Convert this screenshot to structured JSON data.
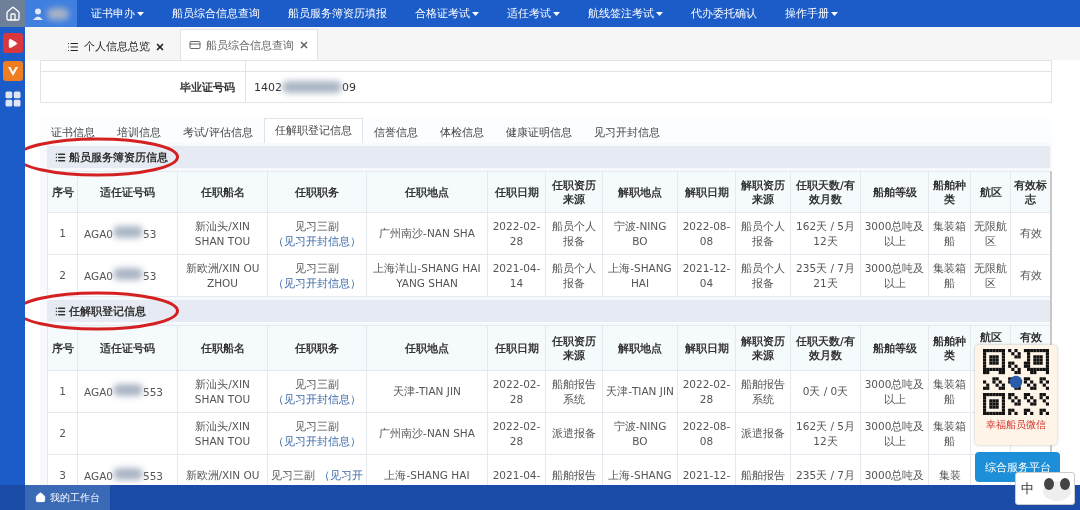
{
  "nav": {
    "items": [
      {
        "label": "证书申办",
        "has_menu": true
      },
      {
        "label": "船员综合信息查询",
        "has_menu": false
      },
      {
        "label": "船员服务簿资历填报",
        "has_menu": false
      },
      {
        "label": "合格证考试",
        "has_menu": true
      },
      {
        "label": "适任考试",
        "has_menu": true
      },
      {
        "label": "航线签注考试",
        "has_menu": true
      },
      {
        "label": "代办委托确认",
        "has_menu": false
      },
      {
        "label": "操作手册",
        "has_menu": true
      }
    ]
  },
  "page_tabs": [
    {
      "label": "个人信息总览",
      "selected": false
    },
    {
      "label": "船员综合信息查询",
      "selected": true
    }
  ],
  "info_table": {
    "label": "毕业证号码",
    "value_start": "1402",
    "value_end": "09"
  },
  "sub_tabs": [
    {
      "label": "证书信息",
      "selected": false
    },
    {
      "label": "培训信息",
      "selected": false
    },
    {
      "label": "考试/评估信息",
      "selected": false
    },
    {
      "label": "任解职登记信息",
      "selected": true
    },
    {
      "label": "信誉信息",
      "selected": false
    },
    {
      "label": "体检信息",
      "selected": false
    },
    {
      "label": "健康证明信息",
      "selected": false
    },
    {
      "label": "见习开封信息",
      "selected": false
    }
  ],
  "sections": [
    {
      "title": "船员服务簿资历信息",
      "columns": [
        "序号",
        "适任证号码",
        "任职船名",
        "任职职务",
        "任职地点",
        "任职日期",
        "任职资历来源",
        "解职地点",
        "解职日期",
        "解职资历来源",
        "任职天数/有效月数",
        "船舶等级",
        "船舶种类",
        "航区",
        "有效标志"
      ],
      "rows": [
        {
          "seq": "1",
          "cert_start": "AGA0",
          "cert_end": "53",
          "ship": "新汕头/XIN SHAN TOU",
          "duty": "见习三副",
          "duty_link": "（见习开封信息）",
          "place": "广州南沙-NAN SHA",
          "on_date": "2022-02-28",
          "on_source": "船员个人报备",
          "off_place": "宁波-NING BO",
          "off_date": "2022-08-08",
          "off_source": "船员个人报备",
          "days": "162天 / 5月12天",
          "grade": "3000总吨及以上",
          "ship_type": "集装箱船",
          "area": "无限航区",
          "flag": "有效"
        },
        {
          "seq": "2",
          "cert_start": "AGA0",
          "cert_end": "53",
          "ship": "新欧洲/XIN OU ZHOU",
          "duty": "见习三副",
          "duty_link": "（见习开封信息）",
          "place": "上海洋山-SHANG HAI YANG SHAN",
          "on_date": "2021-04-14",
          "on_source": "船员个人报备",
          "off_place": "上海-SHANG HAI",
          "off_date": "2021-12-04",
          "off_source": "船员个人报备",
          "days": "235天 / 7月21天",
          "grade": "3000总吨及以上",
          "ship_type": "集装箱船",
          "area": "无限航区",
          "flag": "有效"
        }
      ]
    },
    {
      "title": "任解职登记信息",
      "columns": [
        "序号",
        "适任证号码",
        "任职船名",
        "任职职务",
        "任职地点",
        "任职日期",
        "任职资历来源",
        "解职地点",
        "解职日期",
        "解职资历来源",
        "任职天数/有效月数",
        "船舶等级",
        "船舶种类",
        "航区",
        "有效"
      ],
      "rows": [
        {
          "seq": "1",
          "cert_start": "AGA0",
          "cert_end": "553",
          "ship": "新汕头/XIN SHAN TOU",
          "duty": "见习三副",
          "duty_link": "（见习开封信息）",
          "place": "天津-TIAN JIN",
          "on_date": "2022-02-28",
          "on_source": "船舶报告系统",
          "off_place": "天津-TIAN JIN",
          "off_date": "2022-02-28",
          "off_source": "船舶报告系统",
          "days": "0天 / 0天",
          "grade": "3000总吨及以上",
          "ship_type": "集装箱船"
        },
        {
          "seq": "2",
          "ship": "新汕头/XIN SHAN TOU",
          "duty": "见习三副",
          "duty_link": "（见习开封信息）",
          "place": "广州南沙-NAN SHA",
          "on_date": "2022-02-28",
          "on_source": "派遣报备",
          "off_place": "宁波-NING BO",
          "off_date": "2022-08-08",
          "off_source": "派遣报备",
          "days": "162天 / 5月12天",
          "grade": "3000总吨及以上",
          "ship_type": "集装箱船"
        },
        {
          "seq": "3",
          "cert_start": "AGA0",
          "cert_end": "553",
          "ship": "新欧洲/XIN OU",
          "duty": "见习三副",
          "duty_link": "（见习开",
          "place": "上海-SHANG HAI",
          "on_date": "2021-04-",
          "on_source": "船舶报告",
          "off_place": "上海-SHANG",
          "off_date": "2021-12-",
          "off_source": "船舶报告",
          "days": "235天 / 7月",
          "grade": "3000总吨及",
          "ship_type": "集装"
        }
      ]
    }
  ],
  "qr_widget": {
    "caption": "幸福船员微信",
    "button": "综合服务平台"
  },
  "ime": {
    "label": "中"
  },
  "status_bar": {
    "label": "我的工作台"
  }
}
